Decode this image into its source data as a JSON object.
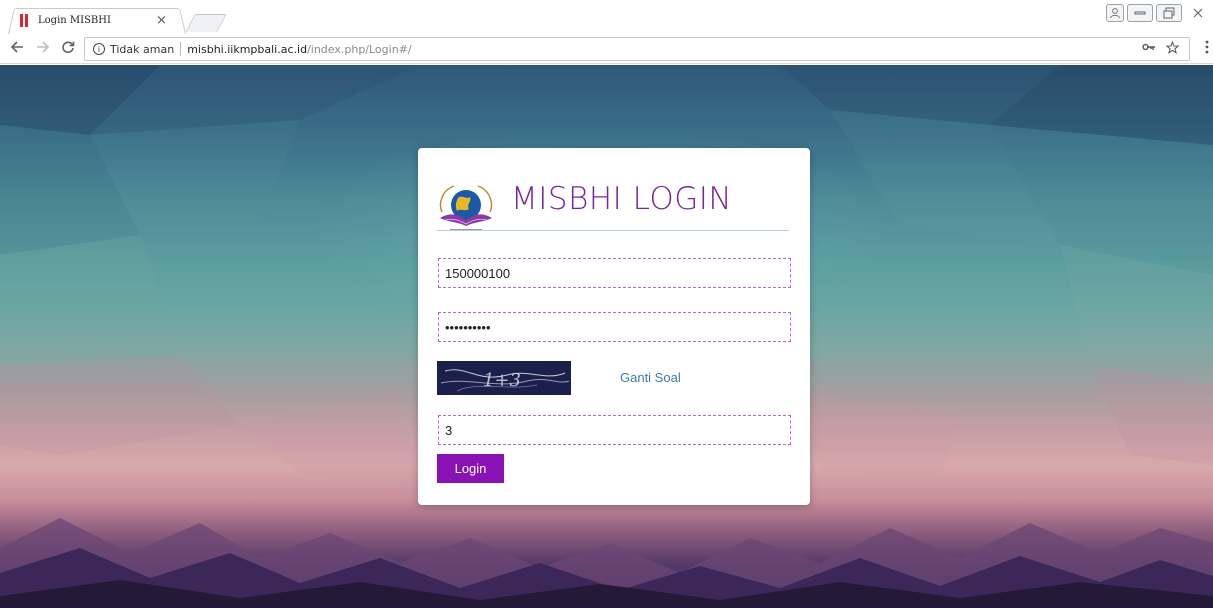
{
  "browser": {
    "tab_title": "Login MISBHI",
    "tab_close": "×",
    "security_label": "Tidak aman",
    "url_host": "misbhi.iikmpbali.ac.id",
    "url_path": "/index.php/Login#/",
    "icons": [
      "back-icon",
      "forward-icon",
      "reload-icon",
      "info-icon",
      "key-icon",
      "star-icon",
      "menu-icon",
      "minimize-icon",
      "maximize-icon",
      "close-icon",
      "profile-icon"
    ]
  },
  "login": {
    "title": "MISBHI LOGIN",
    "username_value": "150000100",
    "password_value": "••••••••••",
    "captcha_text": "1+3",
    "change_captcha_label": "Ganti Soal",
    "captcha_answer": "3",
    "submit_label": "Login"
  },
  "colors": {
    "title": "#7a2694",
    "button": "#8a11b4",
    "field_border": "#c261c9",
    "link": "#3a7ab0"
  }
}
